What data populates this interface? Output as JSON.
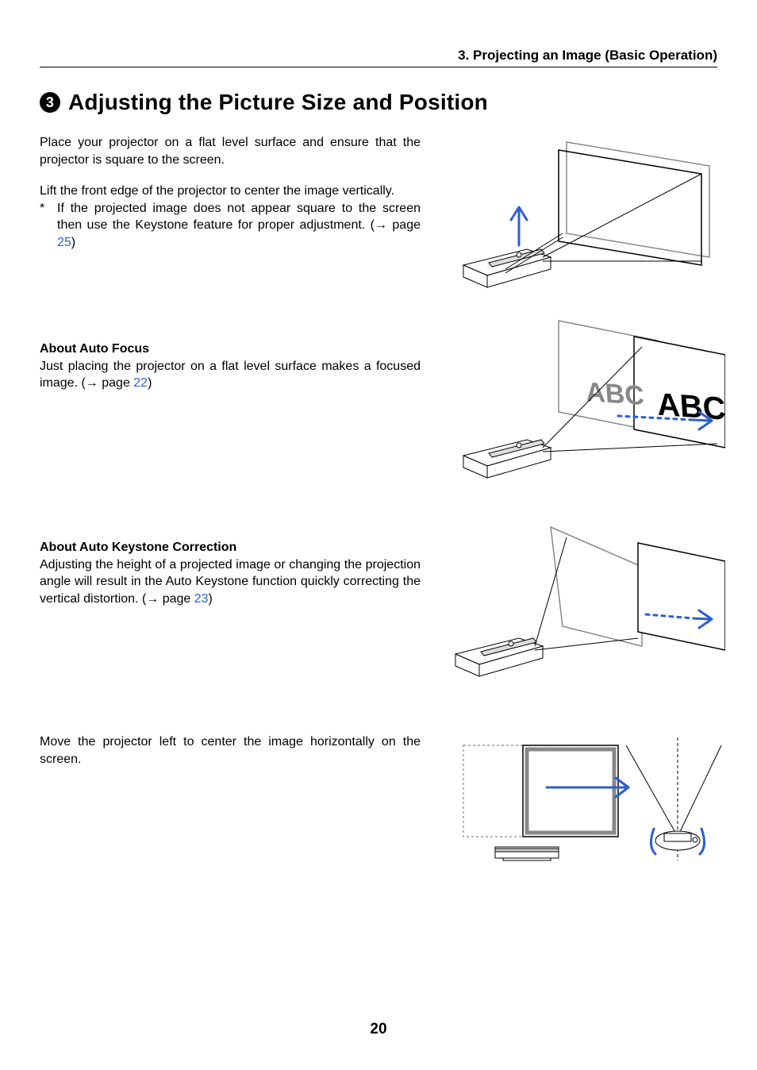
{
  "running_head": "3. Projecting an Image (Basic Operation)",
  "section_number": "3",
  "section_title": "Adjusting the Picture Size and Position",
  "block1": {
    "p1": "Place your projector on a flat level surface and ensure that the projector is square to the screen.",
    "p2": "Lift the front edge of the projector to center the image vertically.",
    "star": "*",
    "note_pre": "If the projected image does not appear square to the screen then use the Keystone feature for proper adjustment. (",
    "arrow": "→",
    "note_mid": " page ",
    "note_link": "25",
    "note_post": ")"
  },
  "block2": {
    "head": "About Auto Focus",
    "body_pre": "Just placing the projector on a flat level surface makes a focused image. (",
    "arrow": "→",
    "body_mid": " page ",
    "body_link": "22",
    "body_post": ")"
  },
  "block3": {
    "head": "About Auto Keystone Correction",
    "body_pre": "Adjusting the height of a projected image or changing the projection angle will result in the Auto Keystone function quickly correcting the vertical distortion. (",
    "arrow": "→",
    "body_mid": " page ",
    "body_link": "23",
    "body_post": ")"
  },
  "block4": {
    "body": "Move the projector left to center the image horizontally on the screen."
  },
  "fig2_label": "ABC",
  "page_number": "20"
}
